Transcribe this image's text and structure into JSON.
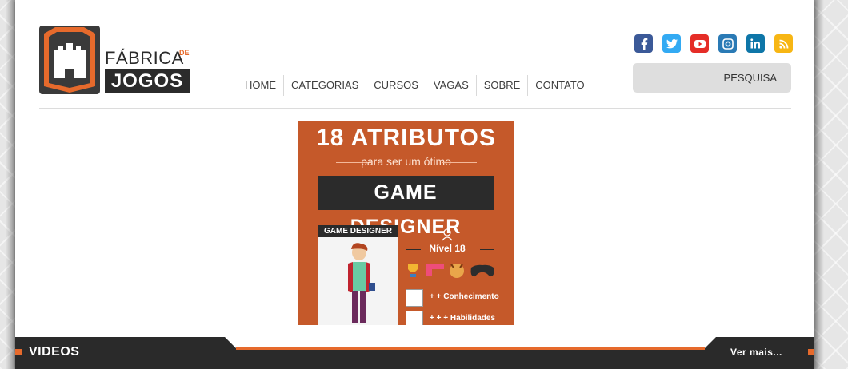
{
  "logo": {
    "line1": "FÁBRICA",
    "de": "DE",
    "line2": "JOGOS"
  },
  "nav": {
    "items": [
      {
        "label": "HOME"
      },
      {
        "label": "CATEGORIAS"
      },
      {
        "label": "CURSOS"
      },
      {
        "label": "VAGAS"
      },
      {
        "label": "SOBRE"
      },
      {
        "label": "CONTATO"
      }
    ]
  },
  "social": [
    {
      "name": "facebook-icon",
      "glyph": "f",
      "color": "#3b5998"
    },
    {
      "name": "twitter-icon",
      "glyph": "t",
      "color": "#33aaf3"
    },
    {
      "name": "youtube-icon",
      "glyph": "▶",
      "color": "#e52d27"
    },
    {
      "name": "instagram-icon",
      "glyph": "◎",
      "color": "#2a7ab5"
    },
    {
      "name": "linkedin-icon",
      "glyph": "in",
      "color": "#0e76a8"
    },
    {
      "name": "rss-icon",
      "glyph": "◔",
      "color": "#f7b614"
    }
  ],
  "search": {
    "placeholder": "PESQUISA"
  },
  "banner": {
    "title": "18 ATRIBUTOS",
    "subtitle": "para ser um ótimo",
    "role": "GAME DESIGNER",
    "card_header": "GAME DESIGNER",
    "level": "Nível 18",
    "stats": [
      {
        "label": "+ + Conhecimento"
      },
      {
        "label": "+ + + Habilidades"
      }
    ]
  },
  "videos": {
    "label": "VIDEOS",
    "more": "Ver mais..."
  },
  "colors": {
    "accent": "#e66a2c",
    "dark": "#2b2b2b",
    "banner_bg": "#c5592a"
  }
}
